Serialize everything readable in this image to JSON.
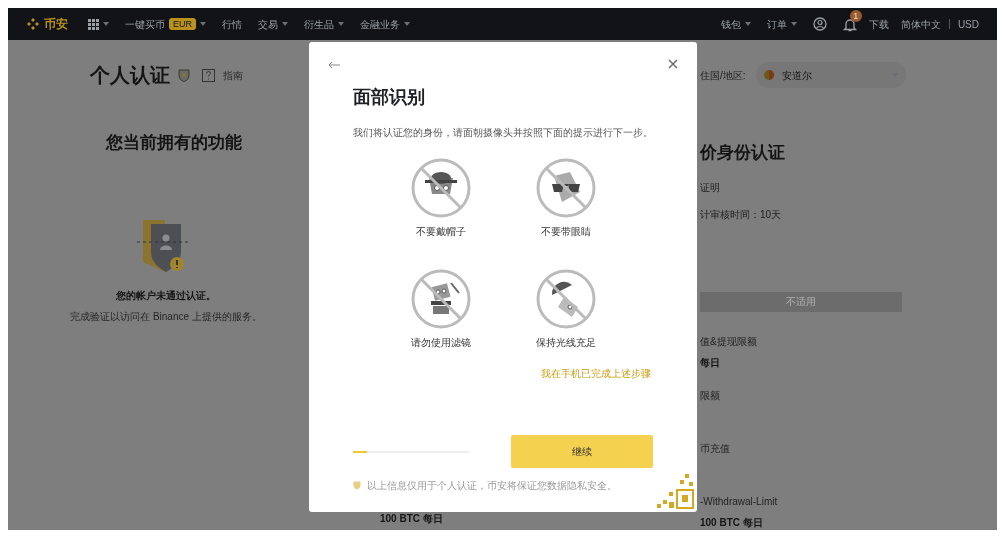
{
  "nav": {
    "logo": "币安",
    "items": [
      {
        "label": "一键买币",
        "badge": "EUR",
        "caret": true
      },
      {
        "label": "行情",
        "caret": false
      },
      {
        "label": "交易",
        "caret": true
      },
      {
        "label": "衍生品",
        "caret": true
      },
      {
        "label": "金融业务",
        "caret": true
      }
    ],
    "right": [
      {
        "label": "钱包",
        "caret": true
      },
      {
        "label": "订单",
        "caret": true
      }
    ],
    "notification_count": "1",
    "links": [
      "下载",
      "简体中文",
      "USD"
    ]
  },
  "page": {
    "title": "个人认证",
    "guide": "指南",
    "left": {
      "heading": "您当前拥有的功能",
      "status": "您的帐户未通过认证。",
      "note": "完成验证以访问在 Binance 上提供的服务。"
    },
    "middle": {
      "limit": "100 BTC 每日"
    },
    "right": {
      "country_label": "住国/地区:",
      "country": "安道尔",
      "heading": "价身份认证",
      "lines": [
        "证明",
        "计审核时间：10天"
      ],
      "button": "不适用",
      "rows": [
        {
          "label": "值&提现限额",
          "value": "每日"
        },
        {
          "label": "限额",
          "value": ""
        },
        {
          "label": "币充值",
          "value": ""
        },
        {
          "label": "-Withdrawal-Limit",
          "value": "100 BTC 每日"
        }
      ]
    }
  },
  "modal": {
    "title": "面部识别",
    "intro": "我们将认证您的身份，请面朝摄像头并按照下面的提示进行下一步。",
    "tips": [
      {
        "kind": "hat",
        "label": "不要戴帽子"
      },
      {
        "kind": "glasses",
        "label": "不要带眼睛"
      },
      {
        "kind": "filter",
        "label": "请勿使用滤镜"
      },
      {
        "kind": "light",
        "label": "保持光线充足"
      }
    ],
    "phone_link": "我在手机已完成上述步骤",
    "progress": {
      "level": 0.12
    },
    "button": "继续",
    "privacy": "以上信息仅用于个人认证，币安将保证您数据隐私安全。"
  }
}
